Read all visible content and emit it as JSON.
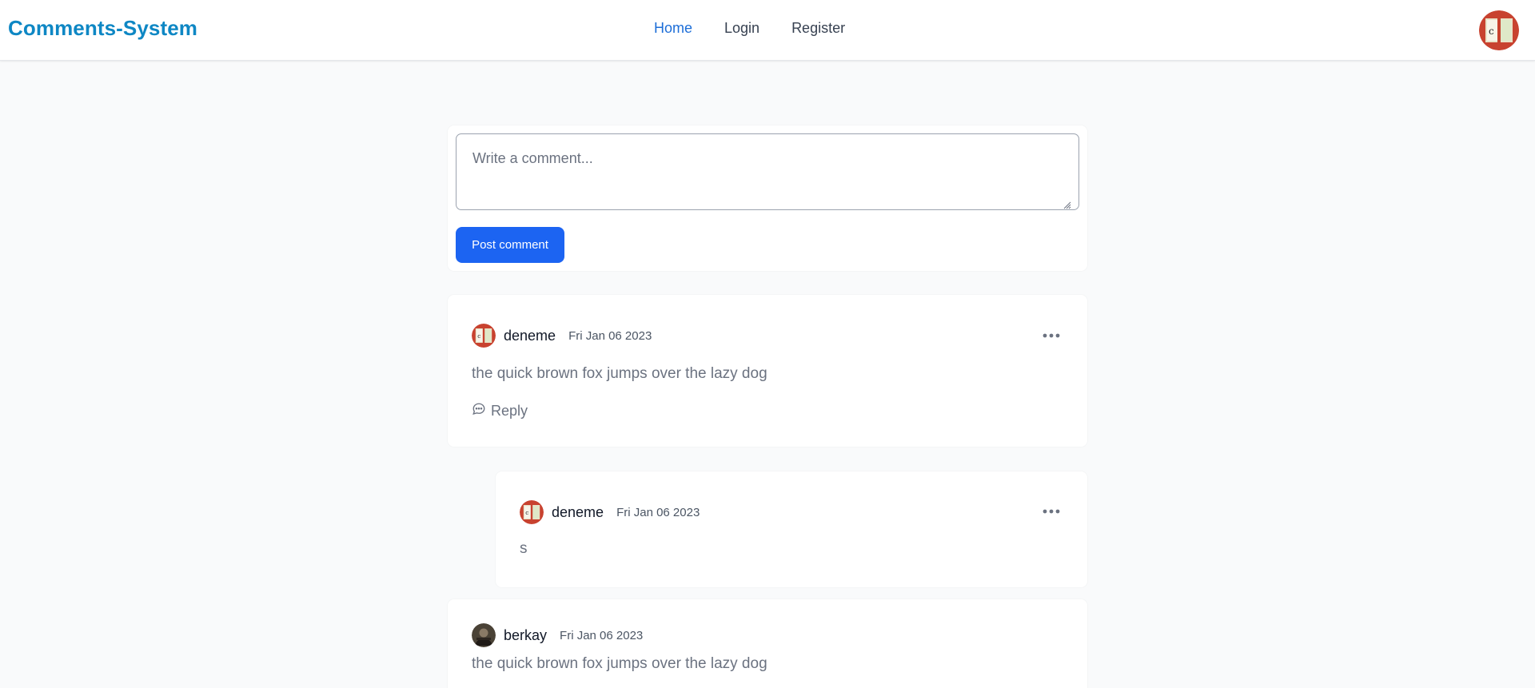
{
  "navbar": {
    "brand": "Comments-System",
    "links": [
      {
        "label": "Home",
        "active": true
      },
      {
        "label": "Login",
        "active": false
      },
      {
        "label": "Register",
        "active": false
      }
    ],
    "avatar_icon": "user-avatar-icon"
  },
  "composer": {
    "placeholder": "Write a comment...",
    "value": "",
    "submit_label": "Post comment"
  },
  "comments": [
    {
      "author": "deneme",
      "date": "Fri Jan 06 2023",
      "text": "the quick brown fox jumps over the lazy dog",
      "reply_label": "Reply",
      "menu_icon": "more-horizontal-icon"
    },
    {
      "author": "deneme",
      "date": "Fri Jan 06 2023",
      "text": "s",
      "menu_icon": "more-horizontal-icon",
      "is_reply": true
    },
    {
      "author": "berkay",
      "date": "Fri Jan 06 2023",
      "text": "the quick brown fox jumps over the lazy dog"
    }
  ],
  "colors": {
    "brand": "#0e87c4",
    "active_link": "#1d6ed8",
    "primary_button": "#1c64f2",
    "page_background": "#f9fafb"
  }
}
